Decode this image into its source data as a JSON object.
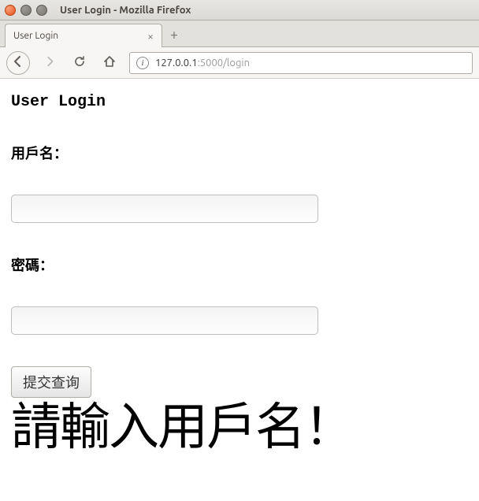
{
  "window": {
    "title": "User Login - Mozilla Firefox"
  },
  "tab": {
    "label": "User Login"
  },
  "urlbar": {
    "host": "127.0.0.1",
    "path": ":5000/login"
  },
  "page": {
    "heading": "User Login",
    "username_label": "用戶名：",
    "password_label": "密碼：",
    "username_value": "",
    "password_value": "",
    "submit_label": "提交查询",
    "error_message": "請輸入用戶名！"
  }
}
